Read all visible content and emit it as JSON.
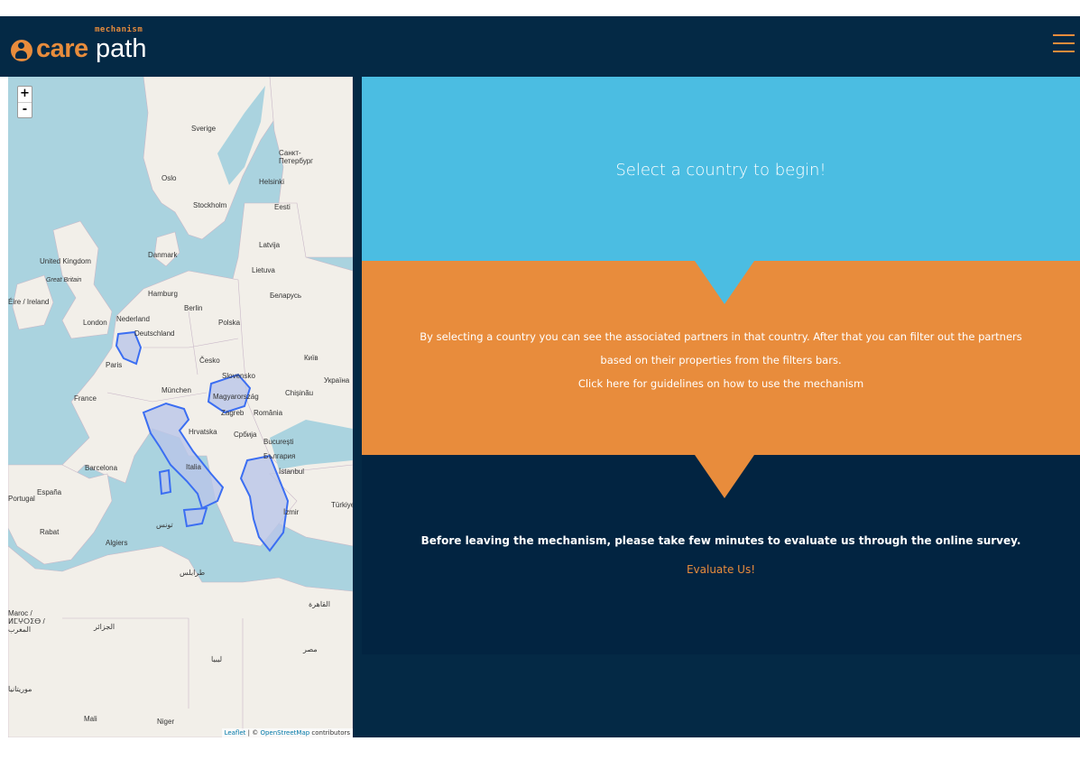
{
  "header": {
    "logo_mechanism": "mechanism",
    "logo_care": "care",
    "logo_path": "path",
    "menu_icon": "hamburger-icon"
  },
  "map": {
    "zoom_in": "+",
    "zoom_out": "-",
    "attribution_leaflet": "Leaflet",
    "attribution_separator": " | © ",
    "attribution_osm": "OpenStreetMap",
    "attribution_suffix": " contributors",
    "labels": {
      "sverige": "Sverige",
      "oslo": "Oslo",
      "stockholm": "Stockholm",
      "helsinki": "Helsinki",
      "sankt": "Санкт-Петербург",
      "eesti": "Eesti",
      "latvija": "Latvija",
      "lietuva": "Lietuva",
      "danmark": "Danmark",
      "united_kingdom": "United Kingdom",
      "great_britain": "Great Britain",
      "eire": "Éire / Ireland",
      "london": "London",
      "nederland": "Nederland",
      "hamburg": "Hamburg",
      "berlin": "Berlin",
      "polska": "Polska",
      "belarus": "Беларусь",
      "deutschland": "Deutschland",
      "paris": "Paris",
      "cesko": "Česko",
      "kyiv": "Київ",
      "ukraina": "Україна",
      "france": "France",
      "munchen": "München",
      "slovensko": "Slovensko",
      "magyarorszag": "Magyarország",
      "chisinau": "Chișinău",
      "zagreb": "Zagreb",
      "romania": "România",
      "hrvatska": "Hrvatska",
      "srbija": "Србија",
      "bucuresti": "București",
      "balgariya": "България",
      "italia": "Italia",
      "barcelona": "Barcelona",
      "espana": "España",
      "istanbul": "İstanbul",
      "portugal": "Portugal",
      "izmir": "İzmir",
      "turkiye": "Türkiye",
      "rabat": "Rabat",
      "algiers": "Algiers",
      "tunis": "تونس",
      "tarabulus": "طرابلس",
      "maroc": "Maroc / ⵍⵎⵖⵔⵉⴱ / المغرب",
      "aljazair": "الجزائر",
      "libya": "ليبيا",
      "misr": "مصر",
      "cairo": "القاهرة",
      "mali": "Mali",
      "niger": "Niger",
      "muritania": "موريتانيا"
    }
  },
  "blue_panel": {
    "title": "Select a country to begin!"
  },
  "orange_panel": {
    "line1": "By selecting a country you can see the associated partners in that country. After that you can filter out the partners",
    "line2": "based on their properties from the filters bars.",
    "guide_link": "Click here for guidelines on how to use the mechanism"
  },
  "navy_panel": {
    "survey_text": "Before leaving the mechanism, please take few minutes to evaluate us through the online survey.",
    "evaluate_link": "Evaluate Us!"
  },
  "colors": {
    "navy": "#042945",
    "blue": "#4bbde2",
    "orange": "#e88c3c",
    "dark_navy": "#022441"
  }
}
